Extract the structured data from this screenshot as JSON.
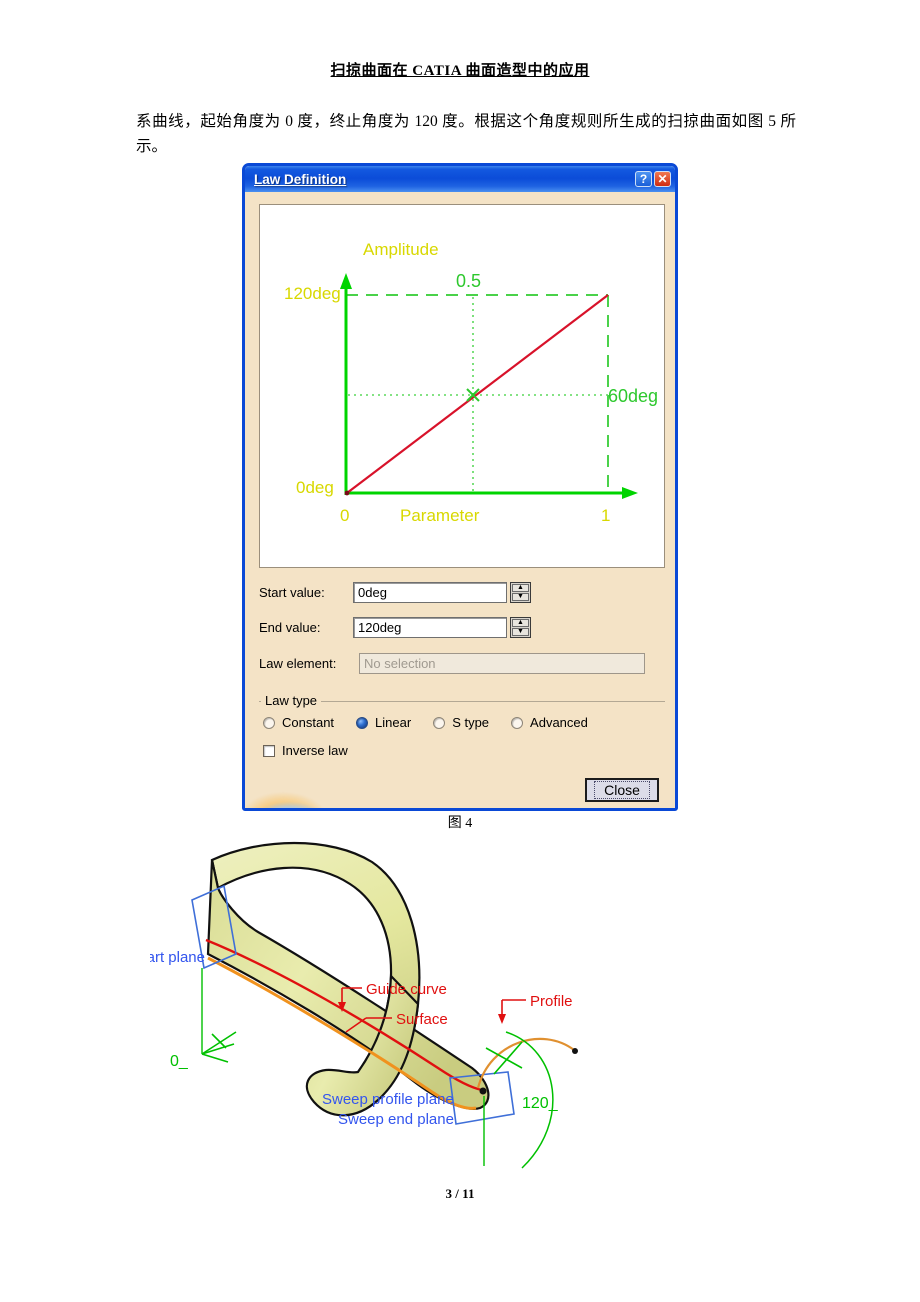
{
  "document": {
    "title": "扫掠曲面在 CATIA 曲面造型中的应用",
    "paragraph": "系曲线，起始角度为 0 度，终止角度为 120 度。根据这个角度规则所生成的扫掠曲面如图 5 所示。",
    "figure_caption": "图 4",
    "page_footer": "3 / 11"
  },
  "dialog": {
    "title": "Law Definition",
    "help_button": "?",
    "close_button_x": "✕",
    "fields": {
      "start_value_label": "Start value:",
      "start_value": "0deg",
      "end_value_label": "End value:",
      "end_value": "120deg",
      "law_element_label": "Law element:",
      "law_element_placeholder": "No selection"
    },
    "law_type": {
      "group_label": "Law type",
      "options": [
        {
          "label": "Constant",
          "selected": false
        },
        {
          "label": "Linear",
          "selected": true
        },
        {
          "label": "S type",
          "selected": false
        },
        {
          "label": "Advanced",
          "selected": false
        }
      ],
      "inverse_law_label": "Inverse law",
      "inverse_law_checked": false
    },
    "close_label": "Close",
    "spinner_up": "▲",
    "spinner_down": "▼"
  },
  "chart_data": {
    "type": "line",
    "title": "",
    "xlabel": "Parameter",
    "ylabel": "Amplitude",
    "xlim": [
      0,
      1
    ],
    "ylim": [
      0,
      120
    ],
    "grid": true,
    "x": [
      0,
      1
    ],
    "values": [
      0,
      120
    ],
    "series": [
      {
        "name": "Linear law",
        "color": "#d8122a",
        "values": [
          0,
          120
        ]
      }
    ],
    "axis_labels": {
      "y_axis_name": "Amplitude",
      "y_max": "120deg",
      "y_min": "0deg",
      "x_min": "0",
      "x_max": "1",
      "x_axis_name": "Parameter"
    },
    "annotations": [
      {
        "text": "0.5",
        "color": "#2dc82d",
        "meaning": "mid parameter marker"
      },
      {
        "text": "60deg",
        "color": "#2dc82d",
        "meaning": "mid amplitude marker"
      }
    ],
    "colors": {
      "axes": "#00d400",
      "curve": "#d8122a",
      "labels_yellow": "#d8d800",
      "labels_green": "#2dc82d"
    }
  },
  "figure": {
    "labels": [
      {
        "text": "Sweep start plane",
        "color": "#3355ee"
      },
      {
        "text": "Guide curve",
        "color": "#e01010"
      },
      {
        "text": "Surface",
        "color": "#e01010"
      },
      {
        "text": "Profile",
        "color": "#e01010"
      },
      {
        "text": "Sweep profile plane",
        "color": "#3355ee"
      },
      {
        "text": "Sweep end plane",
        "color": "#3355ee"
      },
      {
        "text": "0_",
        "color": "#00c000"
      },
      {
        "text": "120_",
        "color": "#00c000"
      }
    ],
    "colors": {
      "surface_fill": "#e8eaa8",
      "guide_curve": "#e01010",
      "profile": "#e09030",
      "plane": "#3f6fd8",
      "angle_marks": "#00c000"
    }
  }
}
